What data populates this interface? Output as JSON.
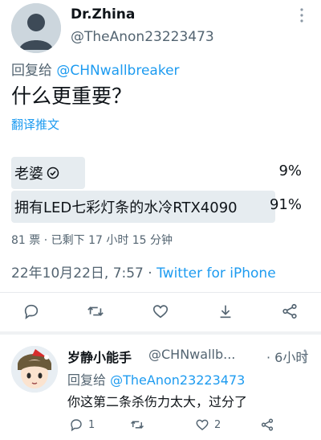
{
  "tweet": {
    "display_name": "Dr.Zhina",
    "handle": "@TheAnon23223473",
    "reply_prefix": "回复给",
    "reply_to": "@CHNwallbreaker",
    "text": "什么更重要？",
    "translate_label": "翻译推文",
    "poll": {
      "options": [
        {
          "label": "老婆",
          "percent_text": "9%",
          "percent": 9,
          "chosen": true
        },
        {
          "label": "拥有LED七彩灯条的水冷RTX4090",
          "percent_text": "91%",
          "percent": 91,
          "chosen": false
        }
      ],
      "meta": "81 票 · 已剩下 17 小时 15 分钟"
    },
    "timestamp": "22年10月22日, 7:57",
    "dot": "·",
    "source": "Twitter for iPhone",
    "actions": [
      "reply-icon",
      "retweet-icon",
      "like-icon",
      "share-icon",
      "share-network-icon"
    ]
  },
  "reply": {
    "display_name": "岁静小能手",
    "handle": "@CHNwallb...",
    "time": "· 6小时",
    "reply_prefix": "回复给",
    "reply_to": "@TheAnon23223473",
    "text": "你这第二条杀伤力太大，过分了",
    "reply_count": "1",
    "like_count": "2"
  },
  "colors": {
    "accent": "#1d9bf0",
    "muted": "#536471",
    "poll_bar": "#e6ecf0"
  }
}
